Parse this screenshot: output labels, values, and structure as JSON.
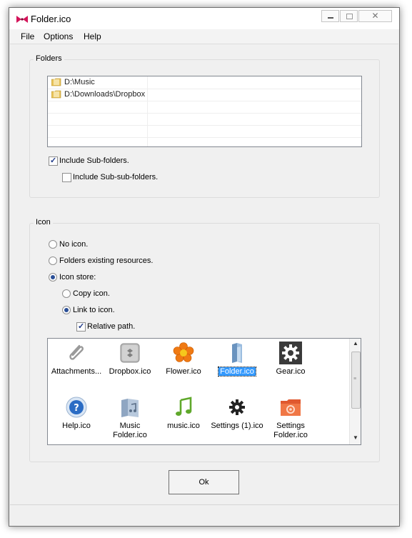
{
  "window": {
    "title": "Folder.ico"
  },
  "menu": {
    "file": "File",
    "options": "Options",
    "help": "Help"
  },
  "folders": {
    "group_label": "Folders",
    "items": [
      "D:\\Music",
      "D:\\Downloads\\Dropbox"
    ],
    "include_subfolders": {
      "label": "Include Sub-folders.",
      "checked": true
    },
    "include_subsubfolders": {
      "label": "Include Sub-sub-folders.",
      "checked": false
    }
  },
  "icon": {
    "group_label": "Icon",
    "no_icon": "No icon.",
    "existing_resources": "Folders existing resources.",
    "icon_store": "Icon store:",
    "copy_icon": "Copy icon.",
    "link_to_icon": "Link to icon.",
    "relative_path": "Relative path.",
    "selected_option": "icon_store",
    "selected_suboption": "link_to_icon",
    "relative_path_checked": true,
    "store_items": [
      {
        "label": "Attachments...",
        "icon": "paperclip-icon"
      },
      {
        "label": "Dropbox.ico",
        "icon": "dropbox-icon"
      },
      {
        "label": "Flower.ico",
        "icon": "flower-icon"
      },
      {
        "label": "Folder.ico",
        "icon": "folder-icon",
        "selected": true
      },
      {
        "label": "Gear.ico",
        "icon": "gear-icon"
      },
      {
        "label": "Help.ico",
        "icon": "help-icon"
      },
      {
        "label": "Music Folder.ico",
        "icon": "music-folder-icon"
      },
      {
        "label": "music.ico",
        "icon": "music-note-icon"
      },
      {
        "label": "Settings (1).ico",
        "icon": "settings-icon"
      },
      {
        "label": "Settings Folder.ico",
        "icon": "settings-folder-icon"
      }
    ]
  },
  "buttons": {
    "ok": "Ok"
  },
  "colors": {
    "selection": "#3399ff",
    "window_bg": "#f0f0f0",
    "border": "#828790"
  }
}
